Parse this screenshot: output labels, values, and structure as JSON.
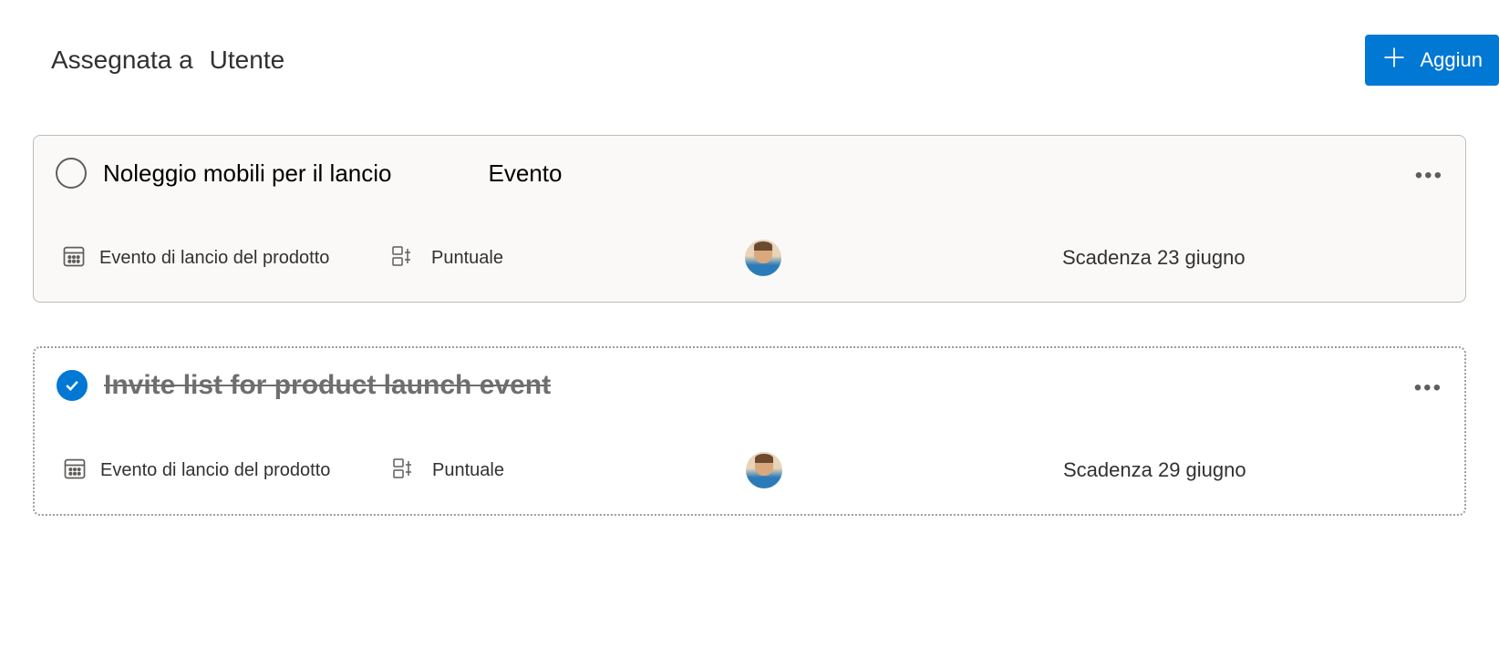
{
  "header": {
    "assigned_to_label": "Assegnata a",
    "user_label": "Utente",
    "add_button_label": "Aggiun"
  },
  "tasks": [
    {
      "completed": false,
      "title": "Noleggio mobili per il lancio",
      "tag": "Evento",
      "project": "Evento di lancio del prodotto",
      "status": "Puntuale",
      "due": "Scadenza 23 giugno"
    },
    {
      "completed": true,
      "title": "Invite list for product launch event",
      "tag": "",
      "project": "Evento di lancio del prodotto",
      "status": "Puntuale",
      "due": "Scadenza 29 giugno"
    }
  ]
}
